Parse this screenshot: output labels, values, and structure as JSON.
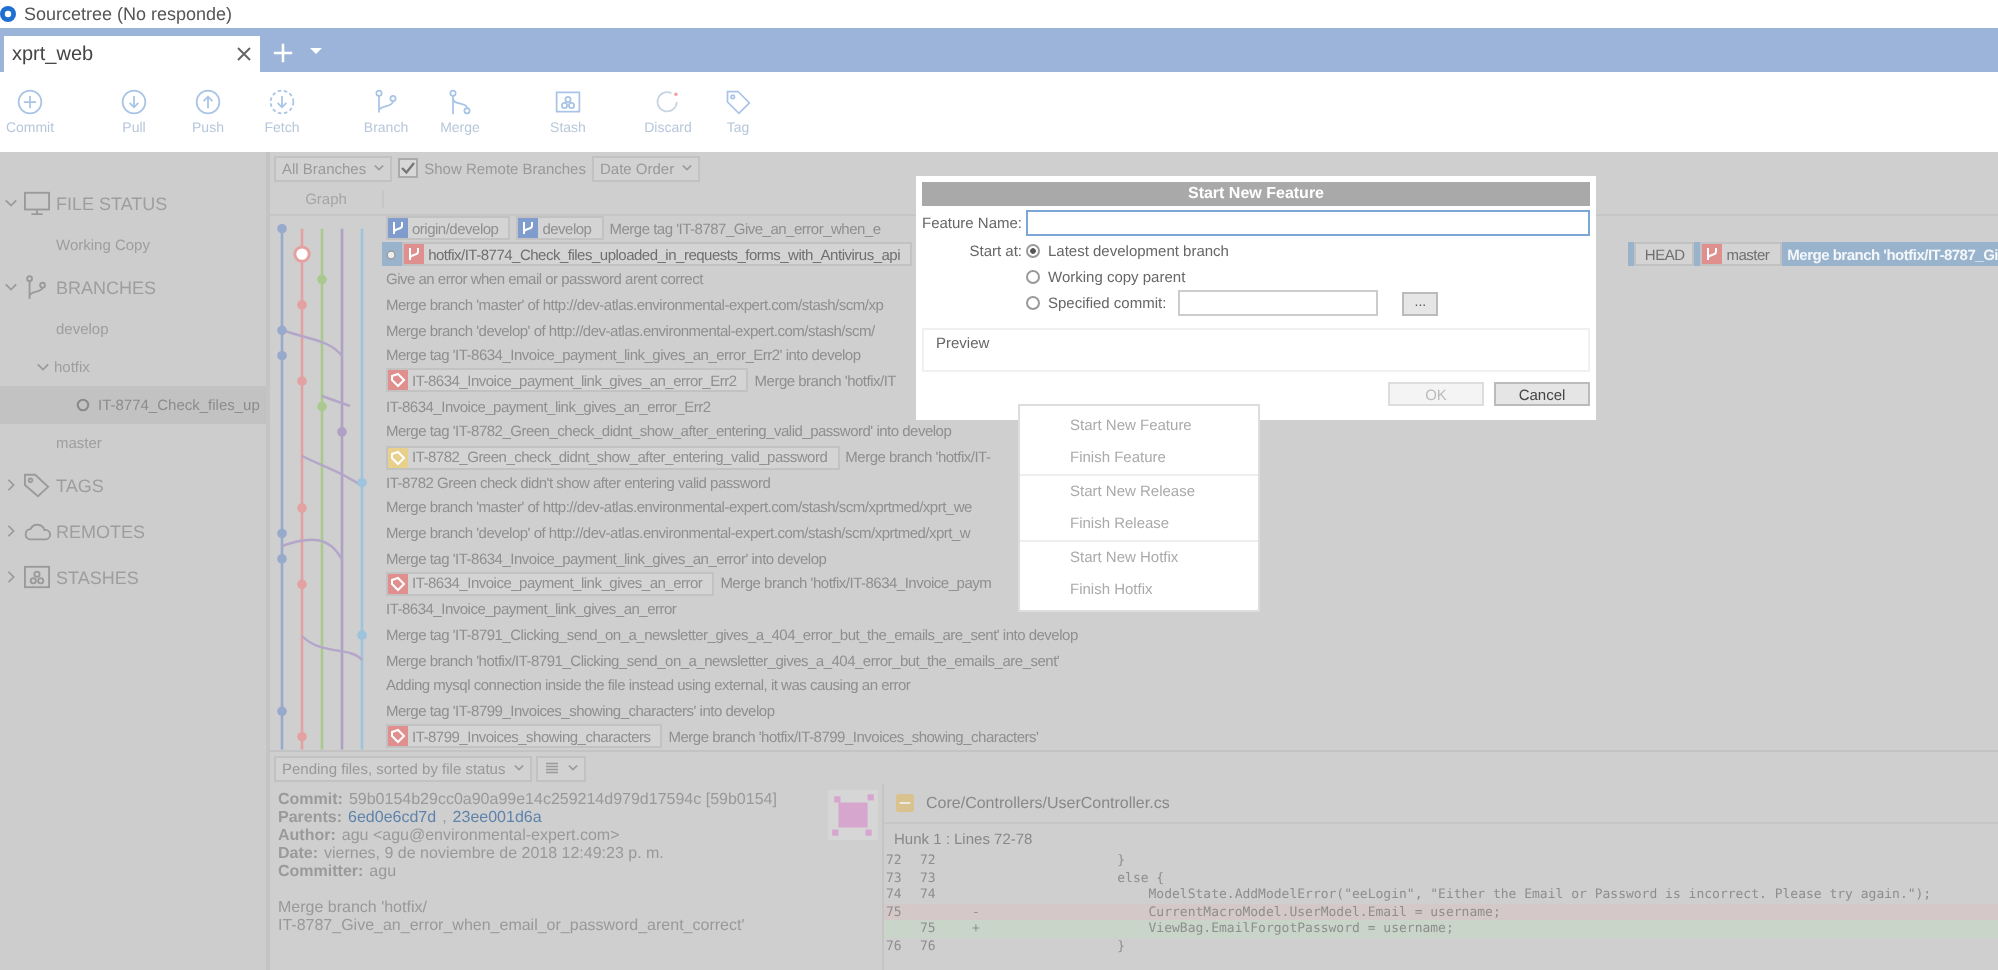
{
  "window": {
    "title": "Sourcetree (No responde)"
  },
  "tabs": [
    {
      "label": "xprt_web",
      "selected": true
    }
  ],
  "toolbar": [
    {
      "label": "Commit"
    },
    {
      "label": "Pull"
    },
    {
      "label": "Push"
    },
    {
      "label": "Fetch"
    },
    {
      "label": "Branch"
    },
    {
      "label": "Merge"
    },
    {
      "label": "Stash"
    },
    {
      "label": "Discard"
    },
    {
      "label": "Tag"
    }
  ],
  "sidebar": [
    {
      "label": "FILE STATUS",
      "expanded": true,
      "children": [
        {
          "label": "Working Copy",
          "selected": false
        }
      ]
    },
    {
      "label": "BRANCHES",
      "expanded": true,
      "children": [
        {
          "label": "develop",
          "selected": false
        },
        {
          "label": "hotfix",
          "expanded": true,
          "children": [
            {
              "label": "IT-8774_Check_files_up",
              "selected": true
            }
          ]
        },
        {
          "label": "master",
          "selected": false
        }
      ]
    },
    {
      "label": "TAGS",
      "expanded": false
    },
    {
      "label": "REMOTES",
      "expanded": false
    },
    {
      "label": "STASHES",
      "expanded": false
    }
  ],
  "filters": {
    "branches": "All Branches",
    "show_remote": {
      "label": "Show Remote Branches",
      "checked": true
    },
    "order": "Date Order"
  },
  "history": {
    "graph_header": "Graph",
    "commits": [
      {
        "selected": false,
        "refs": [
          {
            "kind": "branch",
            "label": "origin/develop",
            "color": "#7f9ccc"
          },
          {
            "kind": "branch",
            "label": "develop",
            "color": "#7f9ccc"
          }
        ],
        "message": "Merge tag 'IT-8787_Give_an_error_when_e"
      },
      {
        "selected": true,
        "current": true,
        "refs": [
          {
            "kind": "branch",
            "label": "hotfix/IT-8774_Check_files_uploaded_in_requests_forms_with_Antivirus_api",
            "color": "#e08f8f"
          }
        ],
        "right_refs": [
          {
            "kind": "head",
            "label": "HEAD"
          },
          {
            "kind": "branch",
            "label": "master",
            "color": "#e08f8f"
          }
        ],
        "right_message": "Merge branch 'hotfix/IT-8787_Gi"
      },
      {
        "selected": false,
        "message": "Give an error when email or password arent correct"
      },
      {
        "selected": false,
        "message": "Merge branch 'master' of http://dev-atlas.environmental-expert.com/stash/scm/xp"
      },
      {
        "selected": false,
        "message": "Merge branch 'develop' of http://dev-atlas.environmental-expert.com/stash/scm/"
      },
      {
        "selected": false,
        "message": "Merge tag 'IT-8634_Invoice_payment_link_gives_an_error_Err2' into develop"
      },
      {
        "selected": false,
        "refs": [
          {
            "kind": "tag",
            "label": "IT-8634_Invoice_payment_link_gives_an_error_Err2",
            "color": "#e08f8f"
          }
        ],
        "message": "Merge branch 'hotfix/IT"
      },
      {
        "selected": false,
        "message": "IT-8634_Invoice_payment_link_gives_an_error_Err2"
      },
      {
        "selected": false,
        "message": "Merge tag 'IT-8782_Green_check_didnt_show_after_entering_valid_password' into develop"
      },
      {
        "selected": false,
        "refs": [
          {
            "kind": "tag",
            "label": "IT-8782_Green_check_didnt_show_after_entering_valid_password",
            "color": "#e8cf8c"
          }
        ],
        "message": "Merge branch 'hotfix/IT-"
      },
      {
        "selected": false,
        "message": "IT-8782 Green check didn't show after entering valid password"
      },
      {
        "selected": false,
        "message": "Merge branch 'master' of http://dev-atlas.environmental-expert.com/stash/scm/xprtmed/xprt_we"
      },
      {
        "selected": false,
        "message": "Merge branch 'develop' of http://dev-atlas.environmental-expert.com/stash/scm/xprtmed/xprt_w"
      },
      {
        "selected": false,
        "message": "Merge tag 'IT-8634_Invoice_payment_link_gives_an_error' into develop"
      },
      {
        "selected": false,
        "refs": [
          {
            "kind": "tag",
            "label": "IT-8634_Invoice_payment_link_gives_an_error",
            "color": "#e08f8f"
          }
        ],
        "message": "Merge branch 'hotfix/IT-8634_Invoice_paym"
      },
      {
        "selected": false,
        "message": "IT-8634_Invoice_payment_link_gives_an_error"
      },
      {
        "selected": false,
        "message": "Merge tag 'IT-8791_Clicking_send_on_a_newsletter_gives_a_404_error_but_the_emails_are_sent' into develop"
      },
      {
        "selected": false,
        "message": "Merge branch 'hotfix/IT-8791_Clicking_send_on_a_newsletter_gives_a_404_error_but_the_emails_are_sent'"
      },
      {
        "selected": false,
        "message": "Adding mysql connection inside the file instead using external, it was causing an error"
      },
      {
        "selected": false,
        "message": "Merge tag 'IT-8799_Invoices_showing_characters' into develop"
      },
      {
        "selected": false,
        "refs": [
          {
            "kind": "tag",
            "label": "IT-8799_Invoices_showing_characters",
            "color": "#e08f8f"
          }
        ],
        "message": "Merge branch 'hotfix/IT-8799_Invoices_showing_characters'"
      }
    ]
  },
  "files_bar": {
    "sort": "Pending files, sorted by file status"
  },
  "details": {
    "fields": [
      {
        "label": "Commit:",
        "value": "59b0154b29cc0a90a99e14c259214d979d17594c [59b0154]"
      },
      {
        "label": "Parents:",
        "links": [
          "6ed0e6cd7d",
          "23ee001d6a"
        ],
        "separator": ","
      },
      {
        "label": "Author:",
        "value": "agu <agu@environmental-expert.com>"
      },
      {
        "label": "Date:",
        "value": "viernes, 9 de noviembre de 2018 12:49:23 p. m."
      },
      {
        "label": "Committer:",
        "value": "agu"
      }
    ],
    "message": [
      "Merge branch 'hotfix/",
      "IT-8787_Give_an_error_when_email_or_password_arent_correct'"
    ]
  },
  "diff": {
    "file": "Core/Controllers/UserController.cs",
    "hunk": "Hunk 1 : Lines 72-78",
    "lines": [
      {
        "kind": "context",
        "old": "72",
        "new": "72",
        "code": "                }"
      },
      {
        "kind": "context",
        "old": "73",
        "new": "73",
        "code": "                else {"
      },
      {
        "kind": "context",
        "old": "74",
        "new": "74",
        "code": "                    ModelState.AddModelError(\"eeLogin\", \"Either the Email or Password is incorrect. Please try again.\");"
      },
      {
        "kind": "removed",
        "old": "75",
        "sign": "-",
        "code": "                    CurrentMacroModel.UserModel.Email = username;"
      },
      {
        "kind": "added",
        "new": "75",
        "sign": "+",
        "code": "                    ViewBag.EmailForgotPassword = username;"
      },
      {
        "kind": "context",
        "old": "76",
        "new": "76",
        "code": "                }"
      }
    ]
  },
  "dialog": {
    "title": "Start New Feature",
    "name_label": "Feature Name:",
    "start_label": "Start at:",
    "options": [
      {
        "label": "Latest development branch",
        "selected": true,
        "kind": "plain"
      },
      {
        "label": "Working copy parent",
        "selected": false,
        "kind": "plain"
      },
      {
        "label": "Specified commit:",
        "selected": false,
        "kind": "commit",
        "browse": "..."
      }
    ],
    "preview": "Preview",
    "buttons": [
      {
        "label": "OK",
        "disabled": true
      },
      {
        "label": "Cancel",
        "disabled": false
      }
    ]
  },
  "menu": {
    "groups": [
      [
        "Start New Feature",
        "Finish Feature"
      ],
      [
        "Start New Release",
        "Finish Release"
      ],
      [
        "Start New Hotfix",
        "Finish Hotfix"
      ]
    ]
  }
}
